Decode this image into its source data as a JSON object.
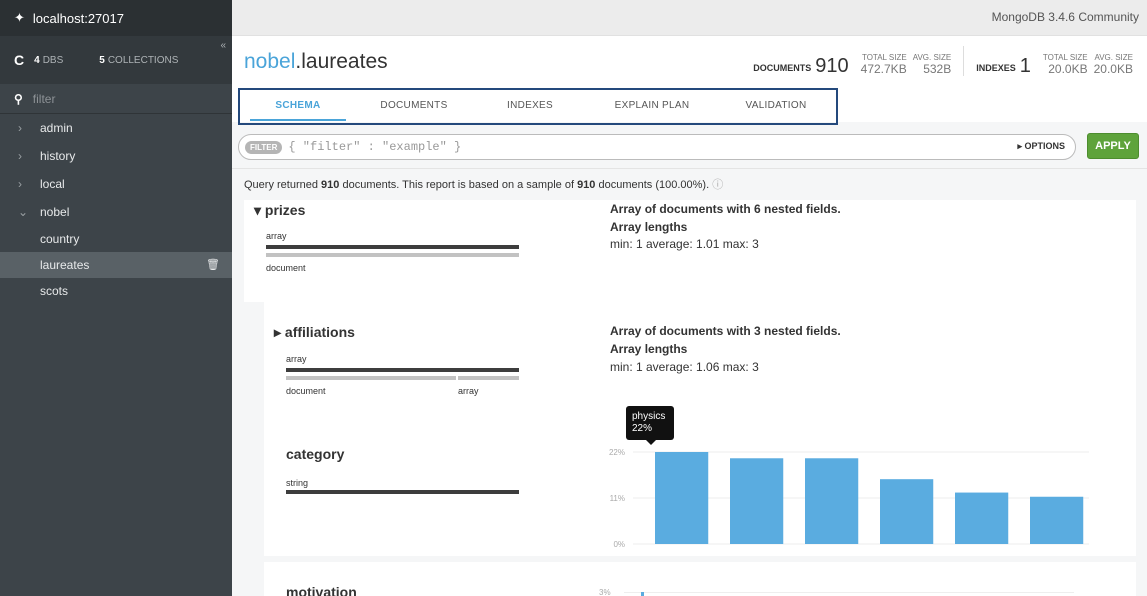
{
  "sidebar": {
    "host": "localhost:27017",
    "dbs_count": "4",
    "dbs_label": "DBS",
    "collections_count": "5",
    "collections_label": "COLLECTIONS",
    "filter_placeholder": "filter",
    "databases": [
      "admin",
      "history",
      "local",
      "nobel"
    ],
    "collections": [
      "country",
      "laureates",
      "scots"
    ],
    "active_collection": "laureates"
  },
  "topbar": {
    "version": "MongoDB 3.4.6 Community"
  },
  "header": {
    "db": "nobel",
    "sep": ".",
    "collection": "laureates",
    "documents_label": "DOCUMENTS",
    "documents_count": "910",
    "doc_total_size_label": "TOTAL SIZE",
    "doc_total_size": "472.7KB",
    "doc_avg_size_label": "AVG. SIZE",
    "doc_avg_size": "532B",
    "indexes_label": "INDEXES",
    "indexes_count": "1",
    "idx_total_size_label": "TOTAL SIZE",
    "idx_total_size": "20.0KB",
    "idx_avg_size_label": "AVG. SIZE",
    "idx_avg_size": "20.0KB"
  },
  "tabs": [
    "SCHEMA",
    "DOCUMENTS",
    "INDEXES",
    "EXPLAIN PLAN",
    "VALIDATION"
  ],
  "query": {
    "chip": "FILTER",
    "placeholder": "{ \"filter\" : \"example\" }",
    "options": "▸ OPTIONS",
    "apply": "APPLY"
  },
  "info": {
    "pre": "Query returned ",
    "count1": "910",
    "mid": " documents. This report is based on a sample of ",
    "count2": "910",
    "post": " documents (100.00%)."
  },
  "fields": {
    "prizes": {
      "name": "prizes",
      "type1": "array",
      "type2": "document",
      "desc": "Array of documents with 6 nested fields.",
      "lengths": "Array lengths",
      "stats": "min: 1   average: 1.01   max: 3"
    },
    "affiliations": {
      "name": "affiliations",
      "type1": "array",
      "type2": "document",
      "type3": "array",
      "desc": "Array of documents with 3 nested fields.",
      "lengths": "Array lengths",
      "stats": "min: 1   average: 1.06   max: 3"
    },
    "category": {
      "name": "category",
      "type1": "string"
    },
    "motivation": {
      "name": "motivation",
      "ytick": "3%"
    }
  },
  "tooltip": {
    "line1": "physics",
    "line2": "22%"
  },
  "chart_data": {
    "type": "bar",
    "title": "",
    "categories": [
      "physics",
      "",
      "",
      "",
      "",
      ""
    ],
    "values": [
      22,
      20.5,
      20.5,
      15.5,
      12.3,
      11.3
    ],
    "ylim": [
      0,
      22
    ],
    "yticks": [
      "22%",
      "11%",
      "0%"
    ],
    "color": "#5aace0"
  },
  "colors": {
    "accent": "#4aa4d9",
    "apply": "#5ea33b",
    "bar": "#5aace0"
  }
}
